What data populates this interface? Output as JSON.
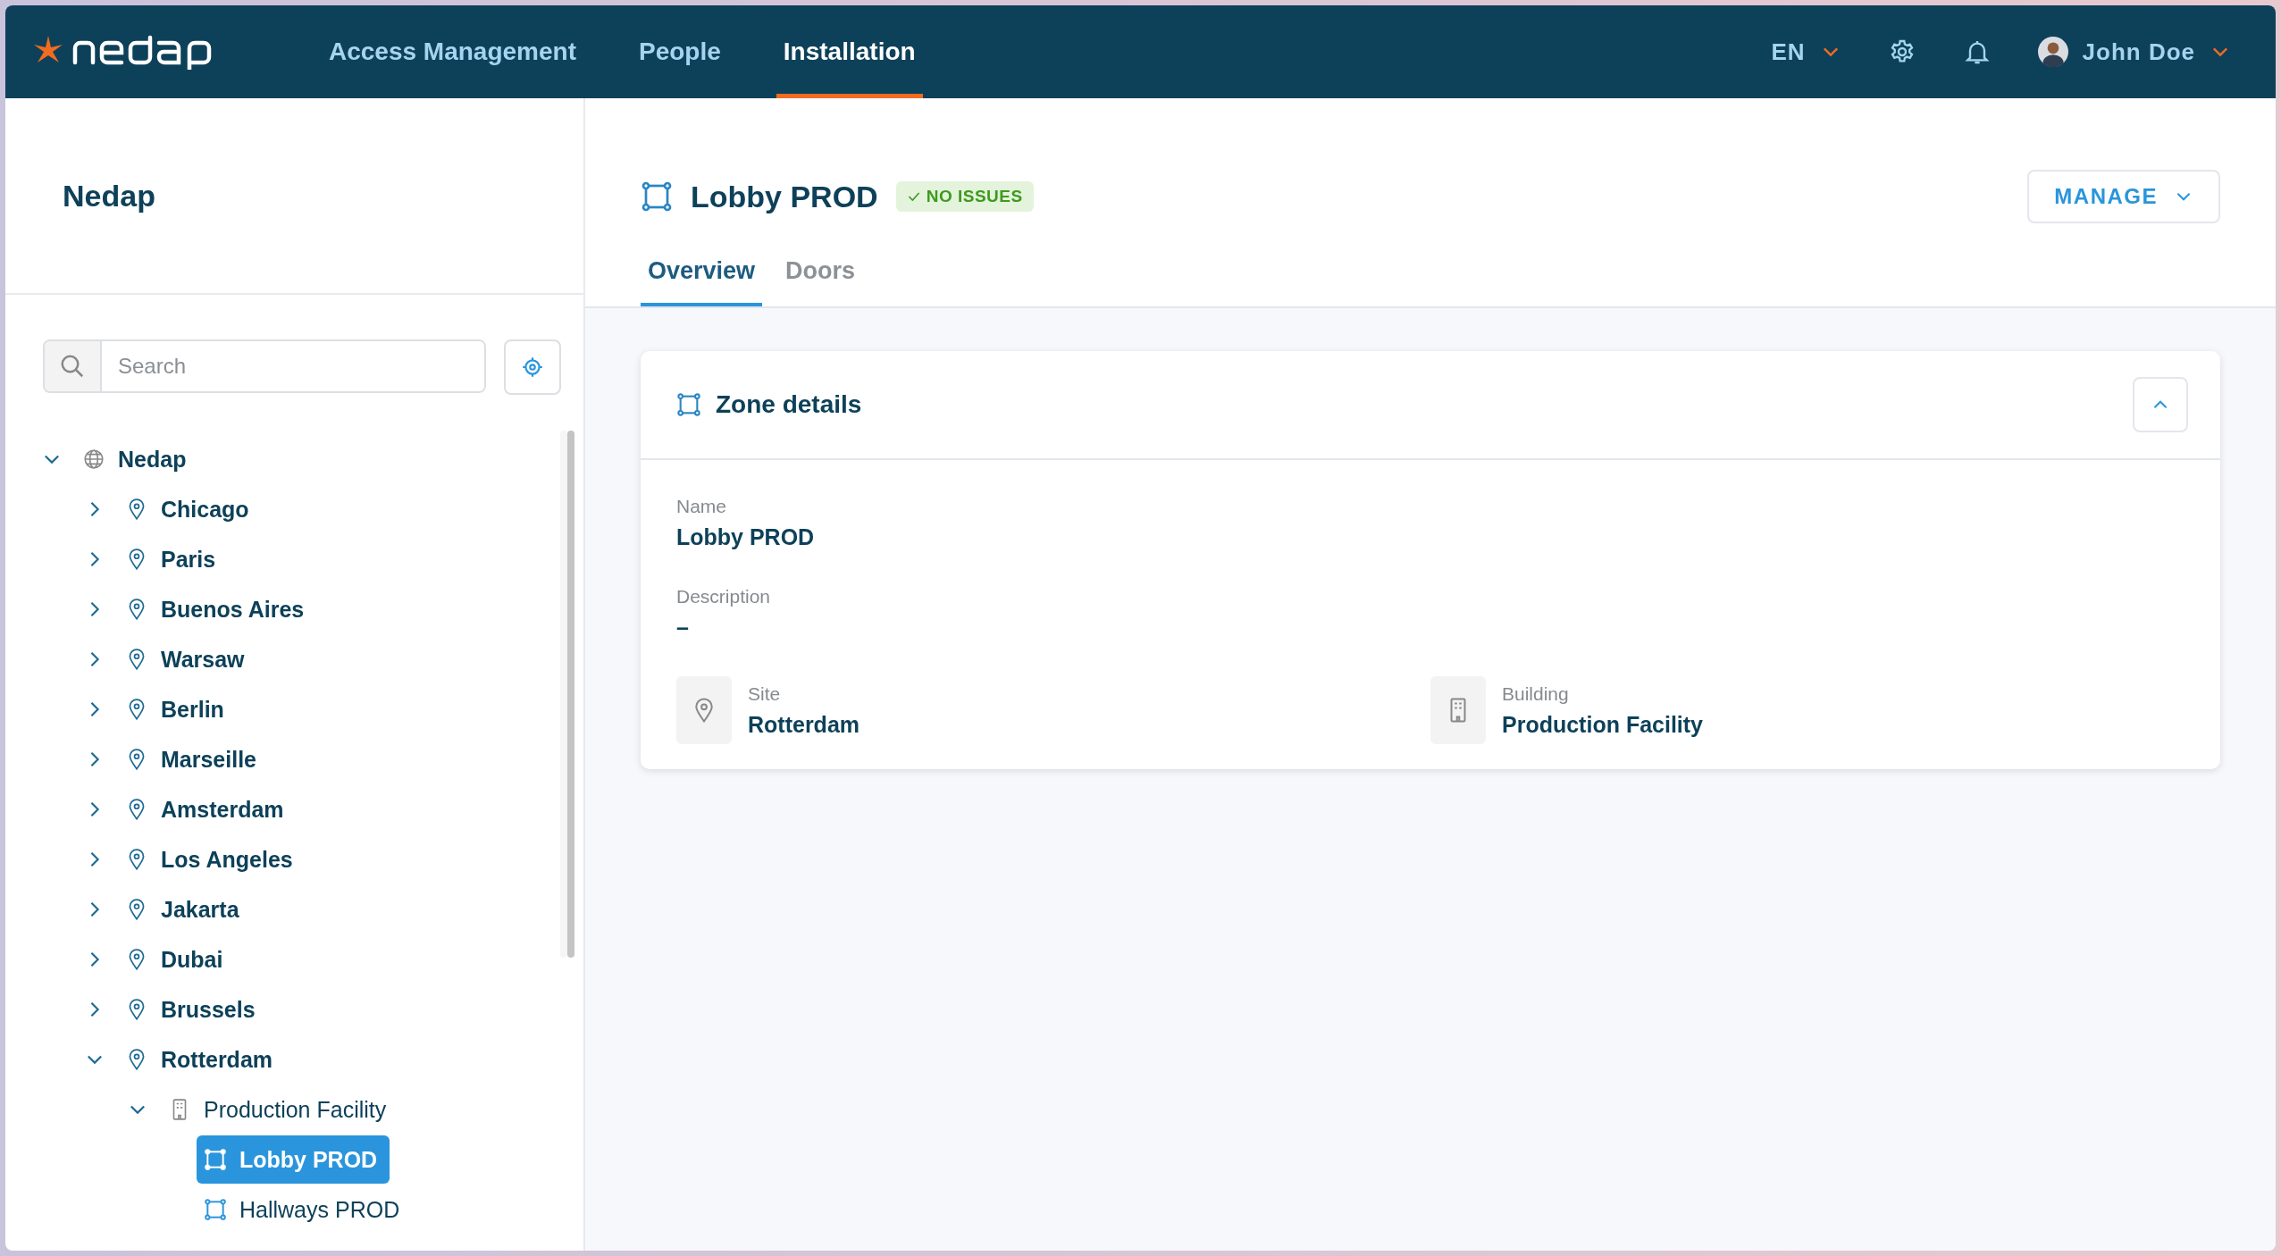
{
  "header": {
    "nav": [
      {
        "label": "Access Management",
        "selected": false
      },
      {
        "label": "People",
        "selected": false
      },
      {
        "label": "Installation",
        "selected": true
      }
    ],
    "language": "EN",
    "user": "John Doe"
  },
  "sidebar": {
    "title": "Nedap",
    "search": {
      "placeholder": "Search"
    },
    "tree": [
      {
        "label": "Nedap",
        "kind": "org",
        "expanded": true,
        "selected": false,
        "children": [
          {
            "label": "Chicago",
            "kind": "site",
            "expanded": false,
            "selected": false
          },
          {
            "label": "Paris",
            "kind": "site",
            "expanded": false,
            "selected": false
          },
          {
            "label": "Buenos Aires",
            "kind": "site",
            "expanded": false,
            "selected": false
          },
          {
            "label": "Warsaw",
            "kind": "site",
            "expanded": false,
            "selected": false
          },
          {
            "label": "Berlin",
            "kind": "site",
            "expanded": false,
            "selected": false
          },
          {
            "label": "Marseille",
            "kind": "site",
            "expanded": false,
            "selected": false
          },
          {
            "label": "Amsterdam",
            "kind": "site",
            "expanded": false,
            "selected": false
          },
          {
            "label": "Los Angeles",
            "kind": "site",
            "expanded": false,
            "selected": false
          },
          {
            "label": "Jakarta",
            "kind": "site",
            "expanded": false,
            "selected": false
          },
          {
            "label": "Dubai",
            "kind": "site",
            "expanded": false,
            "selected": false
          },
          {
            "label": "Brussels",
            "kind": "site",
            "expanded": false,
            "selected": false
          },
          {
            "label": "Rotterdam",
            "kind": "site",
            "expanded": true,
            "selected": false,
            "children": [
              {
                "label": "Production Facility",
                "kind": "building",
                "expanded": true,
                "selected": false,
                "children": [
                  {
                    "label": "Lobby PROD",
                    "kind": "zone",
                    "selected": true
                  },
                  {
                    "label": "Hallways PROD",
                    "kind": "zone",
                    "selected": false
                  }
                ]
              }
            ]
          }
        ]
      }
    ]
  },
  "page": {
    "title": "Lobby PROD",
    "status": {
      "label": "NO ISSUES",
      "kind": "ok"
    },
    "manage": "MANAGE",
    "tabs": [
      {
        "label": "Overview",
        "selected": true
      },
      {
        "label": "Doors",
        "selected": false
      }
    ],
    "card": {
      "title": "Zone details",
      "expanded": true,
      "fields": [
        {
          "label": "Name",
          "value": "Lobby PROD"
        },
        {
          "label": "Description",
          "value": "–"
        }
      ],
      "links": [
        {
          "kind": "site",
          "label": "Site",
          "value": "Rotterdam"
        },
        {
          "kind": "building",
          "label": "Building",
          "value": "Production Facility"
        }
      ]
    }
  }
}
